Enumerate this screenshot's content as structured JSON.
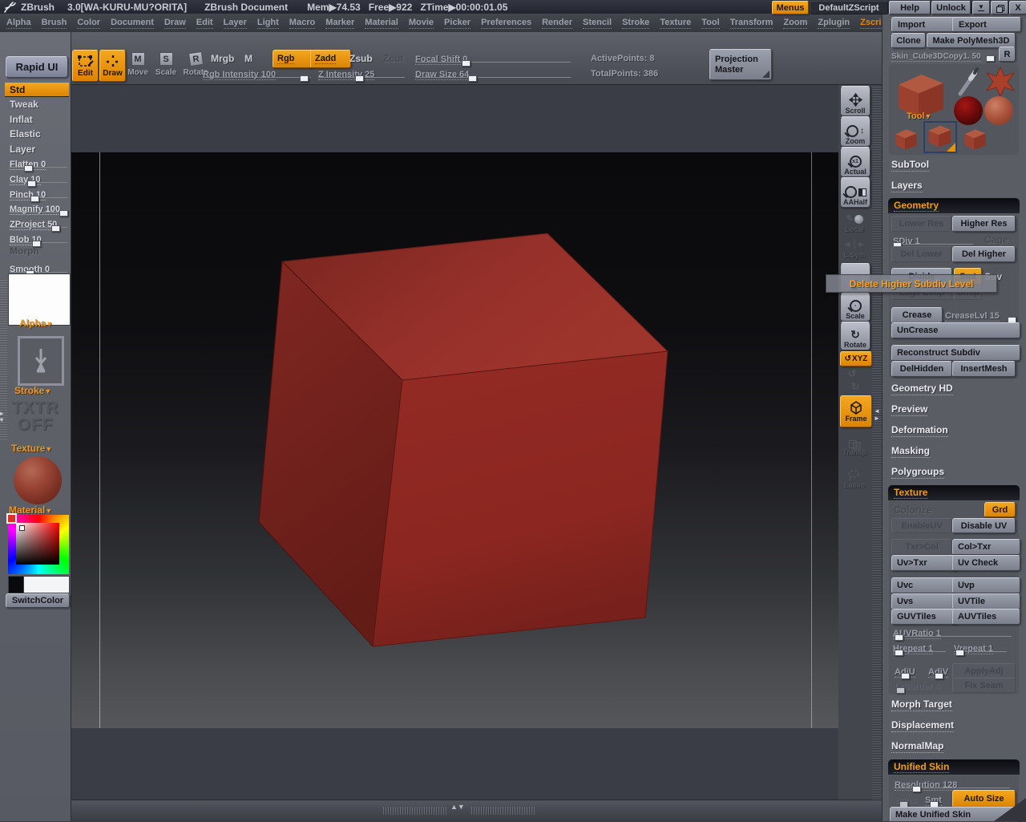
{
  "titlebar": {
    "app": "ZBrush",
    "version": "3.0[WA-KURU-MU?ORITA]",
    "document": "ZBrush Document",
    "mem": "Mem▶74.53",
    "free": "Free▶922",
    "ztime": "ZTime▶00:00:01.05",
    "menus": "Menus",
    "default_zscript": "DefaultZScript",
    "help": "Help",
    "unlock": "Unlock",
    "close": "X"
  },
  "menubar": {
    "items": [
      "Alpha",
      "Brush",
      "Color",
      "Document",
      "Draw",
      "Edit",
      "Layer",
      "Light",
      "Macro",
      "Marker",
      "Material",
      "Movie",
      "Picker",
      "Preferences",
      "Render",
      "Stencil",
      "Stroke",
      "Texture",
      "Tool",
      "Transform",
      "Zoom",
      "Zplugin",
      "Zscript"
    ]
  },
  "toolbar": {
    "edit": "Edit",
    "draw": "Draw",
    "move": "Move",
    "scale": "Scale",
    "rotate": "Rotate",
    "mrgb": "Mrgb",
    "m": "M",
    "rgb": "Rgb",
    "zadd": "Zadd",
    "zsub": "Zsub",
    "zcut": "Zcut",
    "focal_shift": "Focal Shift 0",
    "rgb_intensity": "Rgb Intensity 100",
    "z_intensity": "Z Intensity 25",
    "draw_size": "Draw Size 64",
    "active_points": "ActivePoints: 8",
    "total_points": "TotalPoints: 386",
    "projection_master": "Projection Master"
  },
  "left_sidebar": {
    "rapid_ui": "Rapid UI",
    "std": "Std",
    "tweak": "Tweak",
    "inflat": "Inflat",
    "elastic": "Elastic",
    "layer": "Layer",
    "flatten": "Flatten 0",
    "clay": "Clay 10",
    "pinch": "Pinch 10",
    "magnify": "Magnify 100",
    "zproject": "ZProject 50",
    "blob": "Blob 10",
    "morph": "Morph",
    "smooth": "Smooth 0",
    "alpha": "Alpha",
    "stroke": "Stroke",
    "txtr_line1": "TXTR",
    "txtr_line2": "OFF",
    "texture": "Texture",
    "material": "Material",
    "switch_color": "SwitchColor"
  },
  "icon_strip": {
    "scroll": "Scroll",
    "zoom": "Zoom",
    "actual": "Actual",
    "aahalf": "AAHalf",
    "local": "Local",
    "lsym": "L.Sym",
    "scale": "Scale",
    "rotate": "Rotate",
    "xyz": "XYZ",
    "frame": "Frame",
    "transp": "Transp",
    "lasso": "Lasso"
  },
  "tooltip": "Delete Higher Subdiv Level",
  "right_panel": {
    "import": "Import",
    "export": "Export",
    "clone": "Clone",
    "make_polymesh3d": "Make PolyMesh3D",
    "tool_name_slider": "Skin_Cube3DCopy1. 50",
    "r": "R",
    "tool": "Tool",
    "subtool": "SubTool",
    "layers": "Layers",
    "geometry": {
      "title": "Geometry",
      "lower_res": "Lower Res",
      "higher_res": "Higher Res",
      "sdiv": "SDiv 1",
      "cage": "Cage",
      "del_lower": "Del Lower",
      "del_higher": "Del Higher",
      "divide": "Divide",
      "smt": "Smt",
      "suv": "Suv",
      "edge_loop": "Edge Loop",
      "crisp": "Crisp",
      "crease": "Crease",
      "crease_lvl": "CreaseLvl 15",
      "uncrease": "UnCrease",
      "reconstruct_subdiv": "Reconstruct Subdiv",
      "del_hidden": "DelHidden",
      "insert_mesh": "InsertMesh"
    },
    "geometry_hd": "Geometry HD",
    "preview": "Preview",
    "deformation": "Deformation",
    "masking": "Masking",
    "polygroups": "Polygroups",
    "texture": {
      "title": "Texture",
      "colorize": "Colorize",
      "grd": "Grd",
      "enable_uv": "EnableUV",
      "disable_uv": "Disable UV",
      "txr_col": "Txr>Col",
      "col_txr": "Col>Txr",
      "uv_txr": "Uv>Txr",
      "uv_check": "Uv Check",
      "uvc": "Uvc",
      "uvp": "Uvp",
      "uvs": "Uvs",
      "uvtile": "UVTile",
      "guvtiles": "GUVTiles",
      "auvtiles": "AUVTiles",
      "auv_ratio": "AUVRatio 1",
      "hrepeat": "Hrepeat 1",
      "vrepeat": "Vrepeat 1",
      "adju": "AdjU",
      "adjv": "AdjV",
      "apply_adj": "ApplyAdj",
      "tx_border": "TxBorder 4",
      "fix_seam": "Fix Seam"
    },
    "morph_target": "Morph Target",
    "displacement": "Displacement",
    "normal_map": "NormalMap",
    "unified_skin": {
      "title": "Unified Skin",
      "resolution": "Resolution 128",
      "sdns": "Sdns",
      "smt": "Smt",
      "auto_size": "Auto Size",
      "make_unified_skin": "Make Unified Skin"
    }
  },
  "colors": {
    "accent_orange": "#e8890c",
    "cube_top": "#9c332a",
    "cube_front": "#8d2822",
    "cube_left": "#6f1f1a",
    "canvas_top": "#0b0b0d",
    "canvas_bottom": "#55565b",
    "panel_gray": "#5b5d65"
  }
}
